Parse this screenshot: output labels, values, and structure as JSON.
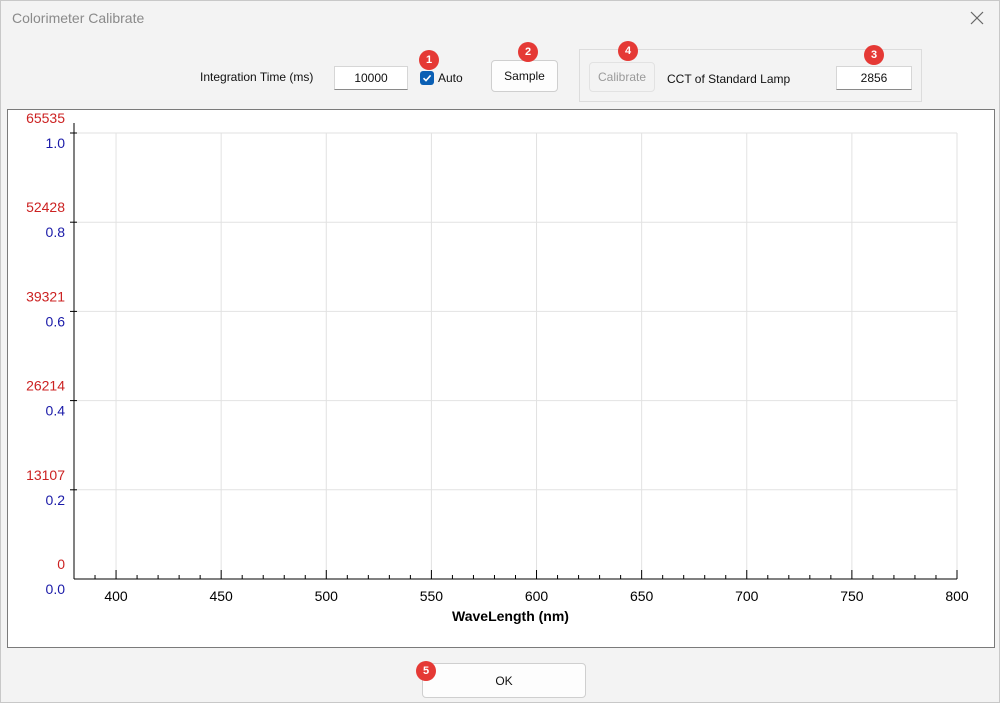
{
  "window": {
    "title": "Colorimeter Calibrate"
  },
  "toolbar": {
    "integration_label": "Integration Time (ms)",
    "integration_value": "10000",
    "auto_label": "Auto",
    "auto_checked": true,
    "sample_label": "Sample",
    "calibrate_label": "Calibrate",
    "cct_label": "CCT of Standard Lamp",
    "cct_value": "2856"
  },
  "badges": [
    "1",
    "2",
    "3",
    "4",
    "5"
  ],
  "footer": {
    "ok_label": "OK"
  },
  "chart_data": {
    "type": "line",
    "xlabel": "WaveLength (nm)",
    "xlim": [
      380,
      800
    ],
    "x_ticks": [
      400,
      450,
      500,
      550,
      600,
      650,
      700,
      750,
      800
    ],
    "y_left_counts_ticks": [
      0,
      13107,
      26214,
      39321,
      52428,
      65535
    ],
    "y_left_ratio_ticks": [
      "0.0",
      "0.2",
      "0.4",
      "0.6",
      "0.8",
      "1.0"
    ],
    "ylim": [
      0,
      1.0
    ],
    "grid": true,
    "series": [],
    "colors": {
      "counts_axis": "#cc2222",
      "ratio_axis": "#1a1aa8",
      "grid": "#e2e2e2"
    }
  }
}
